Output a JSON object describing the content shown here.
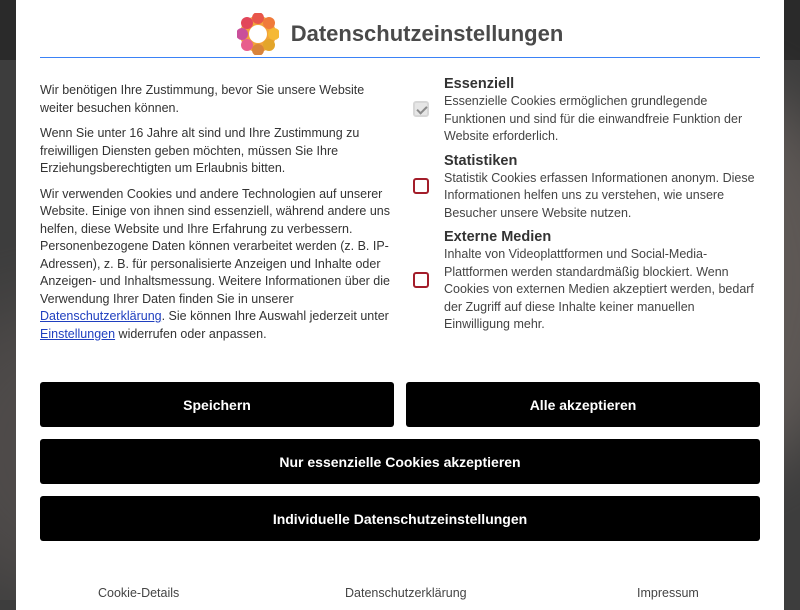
{
  "dialog": {
    "title": "Datenschutzeinstellungen"
  },
  "intro": {
    "p1": "Wir benötigen Ihre Zustimmung, bevor Sie unsere Website weiter besuchen können.",
    "p2": "Wenn Sie unter 16 Jahre alt sind und Ihre Zustimmung zu freiwilligen Diensten geben möchten, müssen Sie Ihre Erziehungsberechtigten um Erlaubnis bitten.",
    "p3_part1": "Wir verwenden Cookies und andere Technologien auf unserer Website. Einige von ihnen sind essenziell, während andere uns helfen, diese Website und Ihre Erfahrung zu verbessern. Personenbezogene Daten können verarbeitet werden (z. B. IP-Adressen), z. B. für personalisierte Anzeigen und Inhalte oder Anzeigen- und Inhaltsmessung. Weitere Informationen über die Verwendung Ihrer Daten finden Sie in unserer ",
    "p3_link1": "Datenschutzerklärung",
    "p3_part2": ". Sie können Ihre Auswahl jederzeit unter ",
    "p3_link2": "Einstellungen",
    "p3_part3": " widerrufen oder anpassen."
  },
  "categories": [
    {
      "name": "Essenziell",
      "description": "Essenzielle Cookies ermöglichen grundlegende Funktionen und sind für die einwandfreie Funktion der Website erforderlich.",
      "checked": true,
      "disabled": true
    },
    {
      "name": "Statistiken",
      "description": "Statistik Cookies erfassen Informationen anonym. Diese Informationen helfen uns zu verstehen, wie unsere Besucher unsere Website nutzen.",
      "checked": false,
      "disabled": false
    },
    {
      "name": "Externe Medien",
      "description": "Inhalte von Videoplattformen und Social-Media-Plattformen werden standardmäßig blockiert. Wenn Cookies von externen Medien akzeptiert werden, bedarf der Zugriff auf diese Inhalte keiner manuellen Einwilligung mehr.",
      "checked": false,
      "disabled": false
    }
  ],
  "buttons": {
    "save": "Speichern",
    "accept_all": "Alle akzeptieren",
    "essential_only": "Nur essenzielle Cookies akzeptieren",
    "individual": "Individuelle Datenschutzeinstellungen"
  },
  "footer": {
    "cookie_details": "Cookie-Details",
    "privacy": "Datenschutzerklärung",
    "imprint": "Impressum"
  },
  "colors": {
    "accent_line": "#3b82f6",
    "checkbox_border": "#a31d2a",
    "button_bg": "#000000"
  }
}
